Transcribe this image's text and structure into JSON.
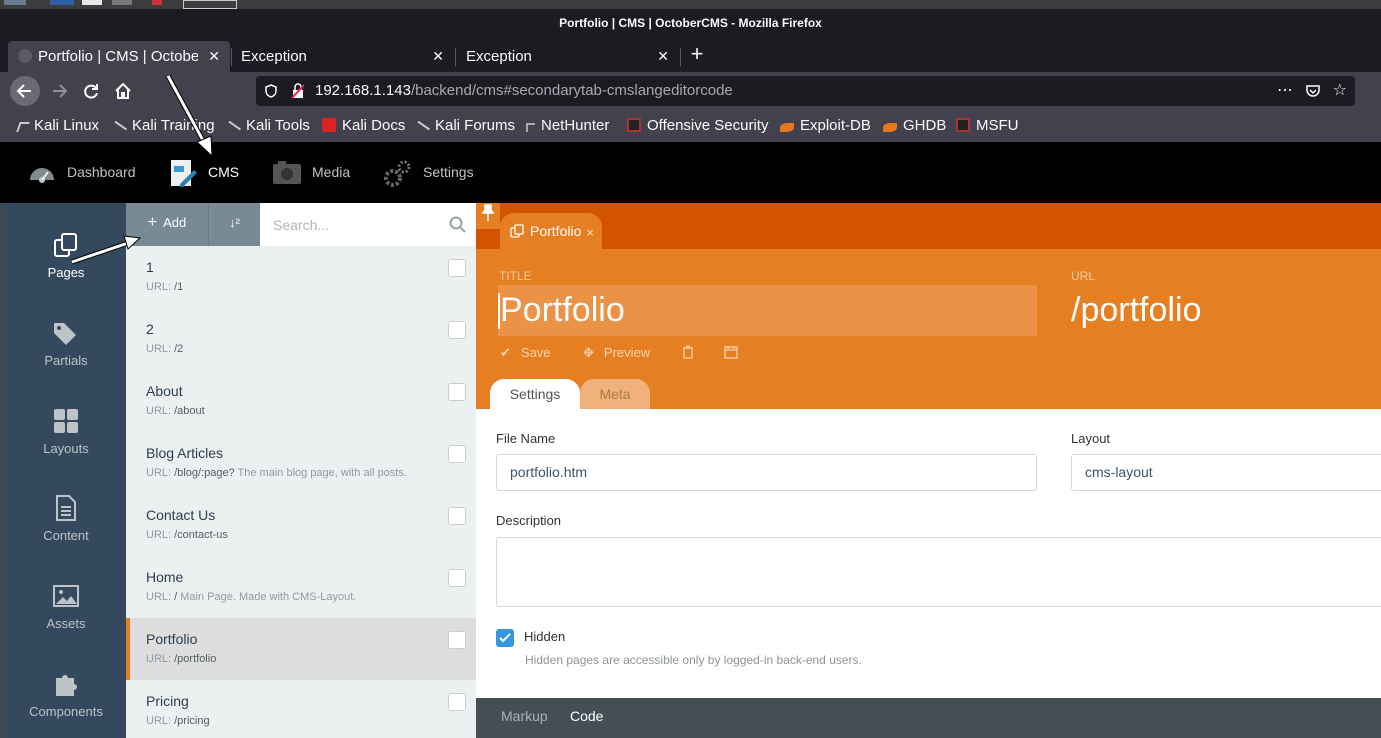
{
  "window": {
    "title": "Portfolio | CMS | OctoberCMS - Mozilla Firefox"
  },
  "browser_tabs": [
    {
      "label": "Portfolio | CMS | October",
      "active": true
    },
    {
      "label": "Exception",
      "active": false
    },
    {
      "label": "Exception",
      "active": false
    }
  ],
  "tab_close_glyph": "✕",
  "new_tab_glyph": "+",
  "url": {
    "host": "192.168.1.143",
    "path": "/backend/cms#secondarytab-cmslangeditorcode"
  },
  "bookmarks": [
    {
      "label": "Kali Linux",
      "icon": "kali-dragon-icon"
    },
    {
      "label": "Kali Training",
      "icon": "kali-dragon-icon"
    },
    {
      "label": "Kali Tools",
      "icon": "kali-dragon-icon"
    },
    {
      "label": "Kali Docs",
      "icon": "kali-docs-icon"
    },
    {
      "label": "Kali Forums",
      "icon": "kali-dragon-icon"
    },
    {
      "label": "NetHunter",
      "icon": "nethunter-icon"
    },
    {
      "label": "Offensive Security",
      "icon": "offsec-icon"
    },
    {
      "label": "Exploit-DB",
      "icon": "exploit-db-icon"
    },
    {
      "label": "GHDB",
      "icon": "ghdb-icon"
    },
    {
      "label": "MSFU",
      "icon": "offsec-icon"
    }
  ],
  "top_nav": [
    {
      "label": "Dashboard",
      "icon": "dashboard-gauge-icon",
      "active": false
    },
    {
      "label": "CMS",
      "icon": "cms-editor-icon",
      "active": true
    },
    {
      "label": "Media",
      "icon": "media-camera-icon",
      "active": false
    },
    {
      "label": "Settings",
      "icon": "settings-gears-icon",
      "active": false
    }
  ],
  "sidebar": [
    {
      "label": "Pages",
      "icon": "pages-icon",
      "active": true
    },
    {
      "label": "Partials",
      "icon": "tags-icon",
      "active": false
    },
    {
      "label": "Layouts",
      "icon": "layout-grid-icon",
      "active": false
    },
    {
      "label": "Content",
      "icon": "document-icon",
      "active": false
    },
    {
      "label": "Assets",
      "icon": "image-icon",
      "active": false
    },
    {
      "label": "Components",
      "icon": "puzzle-icon",
      "active": false
    }
  ],
  "list_toolbar": {
    "add_label": "Add",
    "add_glyph": "+",
    "sort_glyph": "↓²",
    "search_placeholder": "Search..."
  },
  "pages": [
    {
      "title": "1",
      "url_prefix": "URL: ",
      "url": "/1",
      "desc": ""
    },
    {
      "title": "2",
      "url_prefix": "URL: ",
      "url": "/2",
      "desc": ""
    },
    {
      "title": "About",
      "url_prefix": "URL: ",
      "url": "/about",
      "desc": ""
    },
    {
      "title": "Blog Articles",
      "url_prefix": "URL: ",
      "url": "/blog/:page?",
      "desc": " The main blog page, with all posts."
    },
    {
      "title": "Contact Us",
      "url_prefix": "URL: ",
      "url": "/contact-us",
      "desc": ""
    },
    {
      "title": "Home",
      "url_prefix": "URL: ",
      "url": "/",
      "desc": " Main Page. Made with CMS-Layout."
    },
    {
      "title": "Portfolio",
      "url_prefix": "URL: ",
      "url": "/portfolio",
      "desc": "",
      "active": true
    },
    {
      "title": "Pricing",
      "url_prefix": "URL: ",
      "url": "/pricing",
      "desc": ""
    }
  ],
  "editor": {
    "tab_label": "Portfolio",
    "tab_close": "×",
    "title_label": "TITLE",
    "title_value": "Portfolio",
    "url_label": "URL",
    "url_value": "/portfolio",
    "save_label": "Save",
    "preview_label": "Preview",
    "form_tabs": {
      "settings": "Settings",
      "meta": "Meta"
    },
    "file_name_label": "File Name",
    "file_name_value": "portfolio.htm",
    "layout_label": "Layout",
    "layout_value": "cms-layout",
    "description_label": "Description",
    "hidden_label": "Hidden",
    "hidden_checked": true,
    "hidden_help": "Hidden pages are accessible only by logged-in back-end users.",
    "code_tabs": {
      "markup": "Markup",
      "code": "Code"
    }
  }
}
